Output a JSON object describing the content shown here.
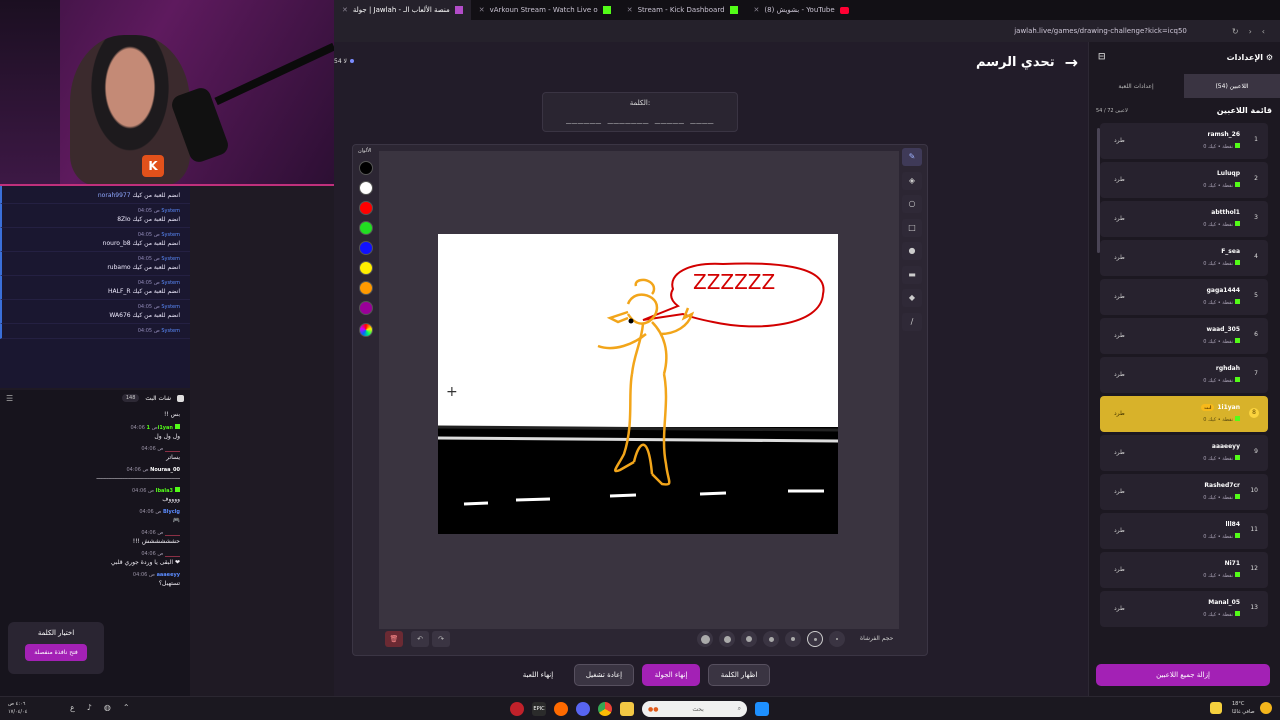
{
  "browser": {
    "tabs": [
      {
        "label": "جولة | Jawlah - منصة الألعاب الـ",
        "active": true
      },
      {
        "label": "vArkoun Stream - Watch Live o"
      },
      {
        "label": "Stream - Kick Dashboard"
      },
      {
        "label": "(8) بشويش - YouTube"
      }
    ],
    "url": "jawlah.live/games/drawing-challenge?kick=icq50"
  },
  "stream_chat_system": [
    {
      "meta": "norah9977",
      "text": "انضم للعبة من كيك",
      "user_only": true
    },
    {
      "time": "04:05 ص",
      "user": "System",
      "text": "8ZIo انضم للعبة من كيك"
    },
    {
      "time": "04:05 ص",
      "user": "System",
      "text": "nouro_b8 انضم للعبة من كيك"
    },
    {
      "time": "04:05 ص",
      "user": "System",
      "text": "rubamo انضم للعبة من كيك"
    },
    {
      "time": "04:05 ص",
      "user": "System",
      "text": "HALF_R انضم للعبة من كيك"
    },
    {
      "time": "04:05 ص",
      "user": "System",
      "text": "WA676 انضم للعبة من كيك"
    },
    {
      "time": "04:05 ص",
      "user": "System",
      "text": ""
    }
  ],
  "chat_header": {
    "title": "شات البث",
    "count": "148"
  },
  "live_chat": [
    {
      "time": "",
      "user": "",
      "text": "!! بس",
      "color": "#ffffff"
    },
    {
      "time": "04:06 ص",
      "user": "1i1yan",
      "text": "ول ول ول",
      "color": "#53fc18"
    },
    {
      "time": "04:06 ص",
      "user": "______",
      "text": "يساتر",
      "color": "#ff4d6d"
    },
    {
      "time": "04:06 ص",
      "user": "Nouraa_00",
      "text": "ـــــــــــــــــــــــــــــــــــــــــــــــــــــــــ",
      "color": "#ffffff"
    },
    {
      "time": "04:06 ص",
      "user": "Ibala3",
      "text": "ووووف",
      "color": "#53fc18"
    },
    {
      "time": "04:06 ص",
      "user": "Blyclg",
      "text": "🎮",
      "color": "#5b8cff"
    },
    {
      "time": "04:06 ص",
      "user": "______",
      "text": "!!! حشششششش",
      "color": "#ff4d6d"
    },
    {
      "time": "04:06 ص",
      "user": "______",
      "text": "البقى يا وردة جوري قلبي ❤",
      "color": "#ff4d6d"
    },
    {
      "time": "04:06 ص",
      "user": "aaaeeyy",
      "text": "تستهبل؟",
      "color": "#5b8cff"
    }
  ],
  "word_card": {
    "title": "اختيار الكلمة",
    "button": "فتح نافذة منفصلة"
  },
  "top_counter": "54 لا",
  "page_title": "تحدي الرسم",
  "word_box": {
    "label": "الكلمة:",
    "dashes": "______ _______ _____ ____"
  },
  "palette": {
    "label": "الألوان",
    "colors": [
      "#000000",
      "#ffffff",
      "#ff0000",
      "#22dd22",
      "#1111ff",
      "#ffee00",
      "#ff9900",
      "#990099"
    ]
  },
  "tools": [
    "pen-icon",
    "eraser-icon",
    "circle-icon",
    "rectangle-icon",
    "filled-circle-icon",
    "filled-rect-icon",
    "fill-bucket-icon",
    "line-icon"
  ],
  "brush_size_label": "حجم الفرشاة",
  "actions": {
    "end_game": "إنهاء اللعبة",
    "restart": "إعادة تشغيل",
    "end_round": "إنهاء الجولة",
    "show_word": "اظهار الكلمة"
  },
  "drawing": {
    "bubble_text": "ZZZZZZ"
  },
  "right_panel": {
    "title": "الإعدادات",
    "tabs": [
      {
        "label": "اللاعبين (54)",
        "active": true
      },
      {
        "label": "إعدادات اللعبة"
      }
    ],
    "list_title": "قائمة اللاعبين",
    "list_count": "54 / 72 لاعبين",
    "kick_label": "طرد",
    "score_label": "0 نقطة • كيك",
    "me_label": "أنت",
    "players": [
      {
        "n": "1",
        "name": "ramsh_26"
      },
      {
        "n": "2",
        "name": "Luluqp"
      },
      {
        "n": "3",
        "name": "abtthol1"
      },
      {
        "n": "4",
        "name": "F_sea"
      },
      {
        "n": "5",
        "name": "gaga1444"
      },
      {
        "n": "6",
        "name": "waad_305"
      },
      {
        "n": "7",
        "name": "rghdah"
      },
      {
        "n": "8",
        "name": "1i1yan",
        "me": true
      },
      {
        "n": "9",
        "name": "aaaeeyy"
      },
      {
        "n": "10",
        "name": "Rashed7cr"
      },
      {
        "n": "11",
        "name": "lll84"
      },
      {
        "n": "12",
        "name": "Ni71"
      },
      {
        "n": "13",
        "name": "Manal_05"
      }
    ],
    "remove_all": "إزالة جميع اللاعبين"
  },
  "taskbar": {
    "time": "٤:٠٦ ص",
    "date": "١٧/٠٤/٠٤",
    "lang": "ع",
    "search_placeholder": "بحث",
    "weather_temp": "18°C",
    "weather_desc": "صافي غالبًا"
  }
}
